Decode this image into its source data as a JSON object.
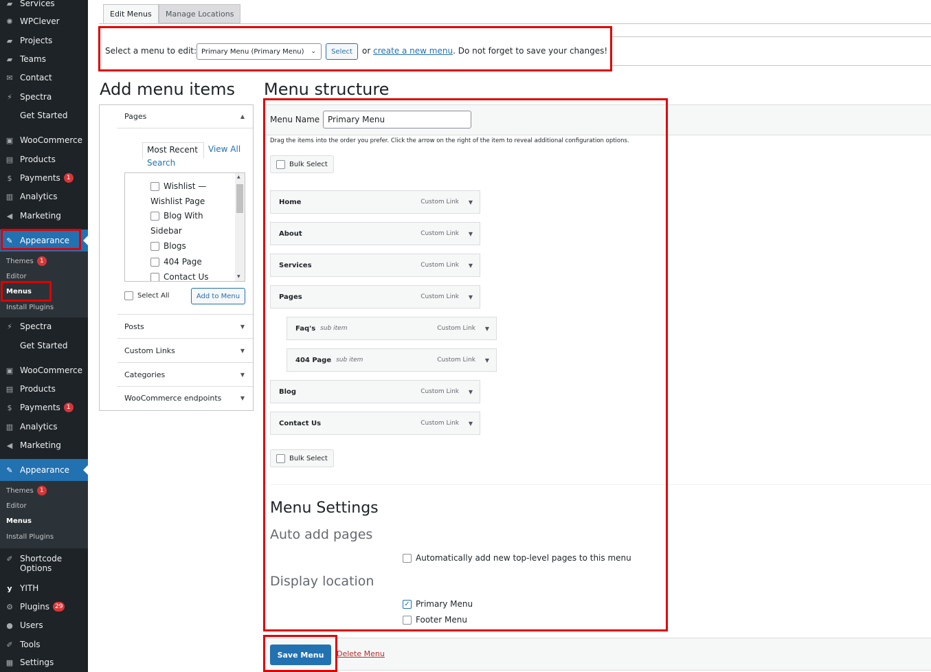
{
  "sidebar": {
    "services": "Services",
    "wpclever": "WPClever",
    "projects": "Projects",
    "teams": "Teams",
    "contact": "Contact",
    "spectra": "Spectra",
    "get_started": "Get Started",
    "woocommerce": "WooCommerce",
    "products": "Products",
    "payments": "Payments",
    "payments_badge": "1",
    "analytics": "Analytics",
    "marketing": "Marketing",
    "appearance": "Appearance",
    "themes": "Themes",
    "themes_badge": "1",
    "editor": "Editor",
    "menus": "Menus",
    "install_plugins": "Install Plugins",
    "shortcode_options": "Shortcode Options",
    "yith": "YITH",
    "plugins": "Plugins",
    "plugins_badge": "29",
    "users": "Users",
    "tools": "Tools",
    "settings": "Settings"
  },
  "tabs": {
    "edit_menus": "Edit Menus",
    "manage_locations": "Manage Locations"
  },
  "select_bar": {
    "label": "Select a menu to edit:",
    "selected": "Primary Menu (Primary Menu)",
    "select_button": "Select",
    "or": "or",
    "create_link": "create a new menu",
    "save_note": ". Do not forget to save your changes!"
  },
  "add_items": {
    "title": "Add menu items",
    "pages_label": "Pages",
    "tab_most_recent": "Most Recent",
    "tab_view_all": "View All",
    "tab_search": "Search",
    "pages": [
      "Wishlist —",
      "Wishlist Page",
      "Blog With",
      "Sidebar",
      "Blogs",
      "404 Page",
      "Contact Us"
    ],
    "select_all": "Select All",
    "add_to_menu": "Add to Menu",
    "posts": "Posts",
    "custom_links": "Custom Links",
    "categories": "Categories",
    "woo_endpoints": "WooCommerce endpoints"
  },
  "structure": {
    "title": "Menu structure",
    "menu_name_label": "Menu Name",
    "menu_name_value": "Primary Menu",
    "instructions": "Drag the items into the order you prefer. Click the arrow on the right of the item to reveal additional configuration options.",
    "bulk_select": "Bulk Select",
    "items": [
      {
        "name": "Home",
        "type": "Custom Link",
        "sub": ""
      },
      {
        "name": "About",
        "type": "Custom Link",
        "sub": ""
      },
      {
        "name": "Services",
        "type": "Custom Link",
        "sub": ""
      },
      {
        "name": "Pages",
        "type": "Custom Link",
        "sub": ""
      },
      {
        "name": "Faq's",
        "type": "Custom Link",
        "sub": "sub item"
      },
      {
        "name": "404 Page",
        "type": "Custom Link",
        "sub": "sub item"
      },
      {
        "name": "Blog",
        "type": "Custom Link",
        "sub": ""
      },
      {
        "name": "Contact Us",
        "type": "Custom Link",
        "sub": ""
      }
    ]
  },
  "settings": {
    "title": "Menu Settings",
    "auto_add": "Auto add pages",
    "auto_add_option": "Automatically add new top-level pages to this menu",
    "display_location": "Display location",
    "primary_menu": "Primary Menu",
    "footer_menu": "Footer Menu",
    "primary_checked": true,
    "footer_checked": false
  },
  "footer": {
    "save_menu": "Save Menu",
    "delete_menu": "Delete Menu"
  },
  "colors": {
    "accent": "#2271b1",
    "sidebar_bg": "#1d2327",
    "highlight_red": "#e00000",
    "badge_red": "#d63638"
  }
}
